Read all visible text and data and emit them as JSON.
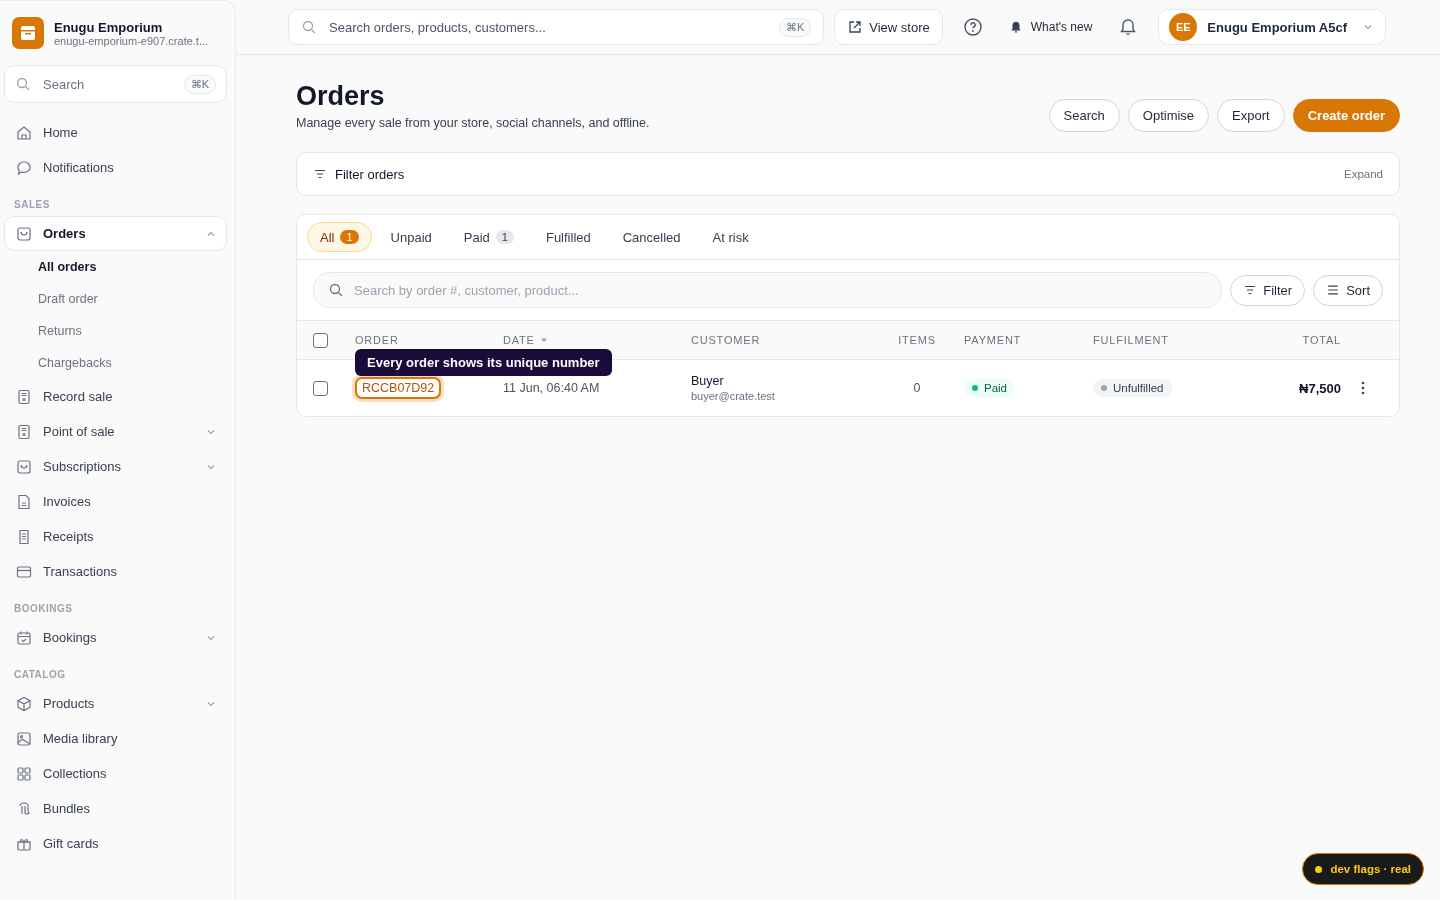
{
  "store": {
    "name": "Enugu Emporium",
    "domain": "enugu-emporium-e907.crate.t..."
  },
  "sidebar_search": {
    "placeholder": "Search",
    "shortcut": "⌘K"
  },
  "sidebar": [
    {
      "items": [
        {
          "label": "Home",
          "selected": false
        },
        {
          "label": "Notifications",
          "selected": false
        }
      ]
    },
    {
      "heading": "SALES",
      "items": [
        {
          "label": "Orders",
          "selected": true,
          "expandable": true,
          "expanded": true,
          "children": [
            {
              "label": "All orders",
              "selected": true
            },
            {
              "label": "Draft order",
              "selected": false
            },
            {
              "label": "Returns",
              "selected": false
            },
            {
              "label": "Chargebacks",
              "selected": false
            }
          ]
        },
        {
          "label": "Record sale",
          "selected": false
        },
        {
          "label": "Point of sale",
          "selected": false,
          "expandable": true,
          "expanded": false
        },
        {
          "label": "Subscriptions",
          "selected": false,
          "expandable": true,
          "expanded": false
        },
        {
          "label": "Invoices",
          "selected": false
        },
        {
          "label": "Receipts",
          "selected": false
        },
        {
          "label": "Transactions",
          "selected": false
        }
      ]
    },
    {
      "heading": "BOOKINGS",
      "items": [
        {
          "label": "Bookings",
          "selected": false,
          "expandable": true,
          "expanded": false
        }
      ]
    },
    {
      "heading": "CATALOG",
      "items": [
        {
          "label": "Products",
          "selected": false,
          "expandable": true,
          "expanded": false
        },
        {
          "label": "Media library",
          "selected": false
        },
        {
          "label": "Collections",
          "selected": false
        },
        {
          "label": "Bundles",
          "selected": false
        },
        {
          "label": "Gift cards",
          "selected": false
        }
      ]
    }
  ],
  "topbar": {
    "search": {
      "placeholder": "Search orders, products, customers...",
      "shortcut": "⌘K"
    },
    "view_store": "View store",
    "whats_new": "What's new",
    "account": {
      "initials": "EE",
      "name": "Enugu Emporium A5cf"
    }
  },
  "page": {
    "title": "Orders",
    "subtitle": "Manage every sale from your store, social channels, and offline.",
    "actions": [
      {
        "label": "Search",
        "kind": "outline"
      },
      {
        "label": "Optimise",
        "kind": "outline"
      },
      {
        "label": "Export",
        "kind": "outline"
      },
      {
        "label": "Create order",
        "kind": "primary"
      }
    ]
  },
  "filter_panel": {
    "label": "Filter orders",
    "toggle": "Expand"
  },
  "tabs": [
    {
      "label": "All",
      "count": "1",
      "selected": true
    },
    {
      "label": "Unpaid",
      "selected": false
    },
    {
      "label": "Paid",
      "count": "1",
      "selected": false
    },
    {
      "label": "Fulfilled",
      "selected": false
    },
    {
      "label": "Cancelled",
      "selected": false
    },
    {
      "label": "At risk",
      "selected": false
    }
  ],
  "table_search": {
    "placeholder": "Search by order #, customer, product..."
  },
  "table_buttons": [
    "Filter",
    "Sort"
  ],
  "table": {
    "select_all_checked": false,
    "columns": [
      "ORDER",
      "DATE",
      "CUSTOMER",
      "ITEMS",
      "PAYMENT",
      "FULFILMENT",
      "TOTAL"
    ],
    "rows": [
      {
        "checked": false,
        "order": "RCCB07D92",
        "date": "11 Jun, 06:40 AM",
        "customer": "Buyer",
        "email": "buyer@crate.test",
        "items": "0",
        "payment": {
          "label": "Paid",
          "color": "#10b981"
        },
        "fulfilment": {
          "label": "Unfulfilled",
          "color": "#9ca3af"
        },
        "total": "₦7,500"
      }
    ]
  },
  "tooltip": "Every order shows its unique number",
  "dev_badge": "dev flags · real"
}
